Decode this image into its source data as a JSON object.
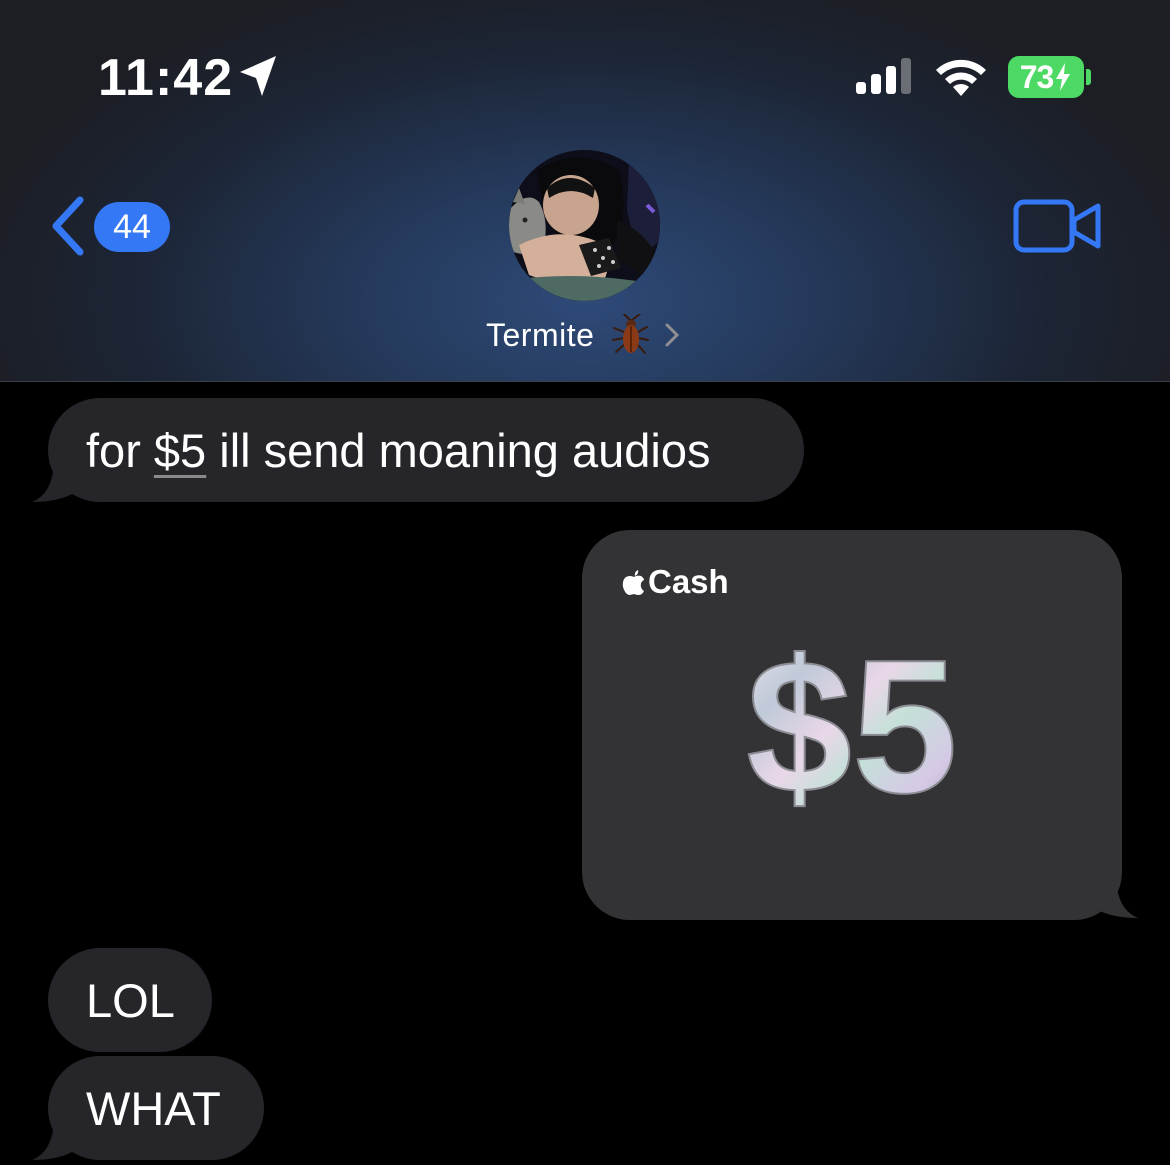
{
  "status_bar": {
    "time": "11:42",
    "battery_level": "73",
    "battery_charging": true,
    "battery_color": "#4cd964",
    "icons": [
      "location-icon",
      "cellular-signal-icon",
      "wifi-icon",
      "battery-icon"
    ]
  },
  "header": {
    "back_badge_count": "44",
    "contact_name": "Termite",
    "contact_emoji": "cockroach-icon",
    "accent_color": "#3478f6"
  },
  "messages": [
    {
      "direction": "incoming",
      "text_before": "for ",
      "link_text": "$5",
      "text_after": " ill send moaning audios"
    },
    {
      "direction": "outgoing",
      "type": "apple-cash",
      "brand_label": "Cash",
      "amount": "$5"
    },
    {
      "direction": "incoming",
      "text": "LOL"
    },
    {
      "direction": "incoming",
      "text": "WHAT"
    }
  ]
}
